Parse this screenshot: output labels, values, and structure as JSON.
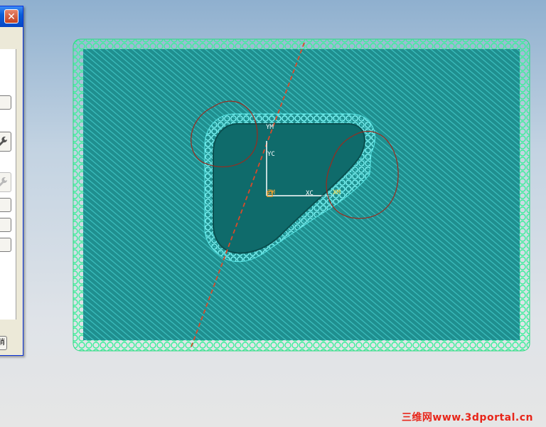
{
  "dialog": {
    "close_glyph": "✕",
    "bottom_button_label": "消"
  },
  "viewport": {
    "wcs_labels": {
      "xm": "XM",
      "ym": "YM",
      "xc": "XC",
      "yc": "YC",
      "zm": "ZM"
    }
  },
  "watermark": {
    "text": "三维网www.3dportal.cn"
  },
  "colors": {
    "background_top": "#8fb0cf",
    "background_bottom": "#e6e6e6",
    "stock_fill": "#1f8f8f",
    "hatch": "#36b8b8",
    "boundary_green": "#3cf09a",
    "pocket_cyan": "#60f0f0",
    "island_fill": "#0f6b6b",
    "center_line": "#d84a2a",
    "sketch_curve": "#9a2b1e",
    "watermark_red": "#e8261a"
  },
  "icons": [
    "close-icon",
    "wrench-icon",
    "wrench-disabled-icon"
  ]
}
